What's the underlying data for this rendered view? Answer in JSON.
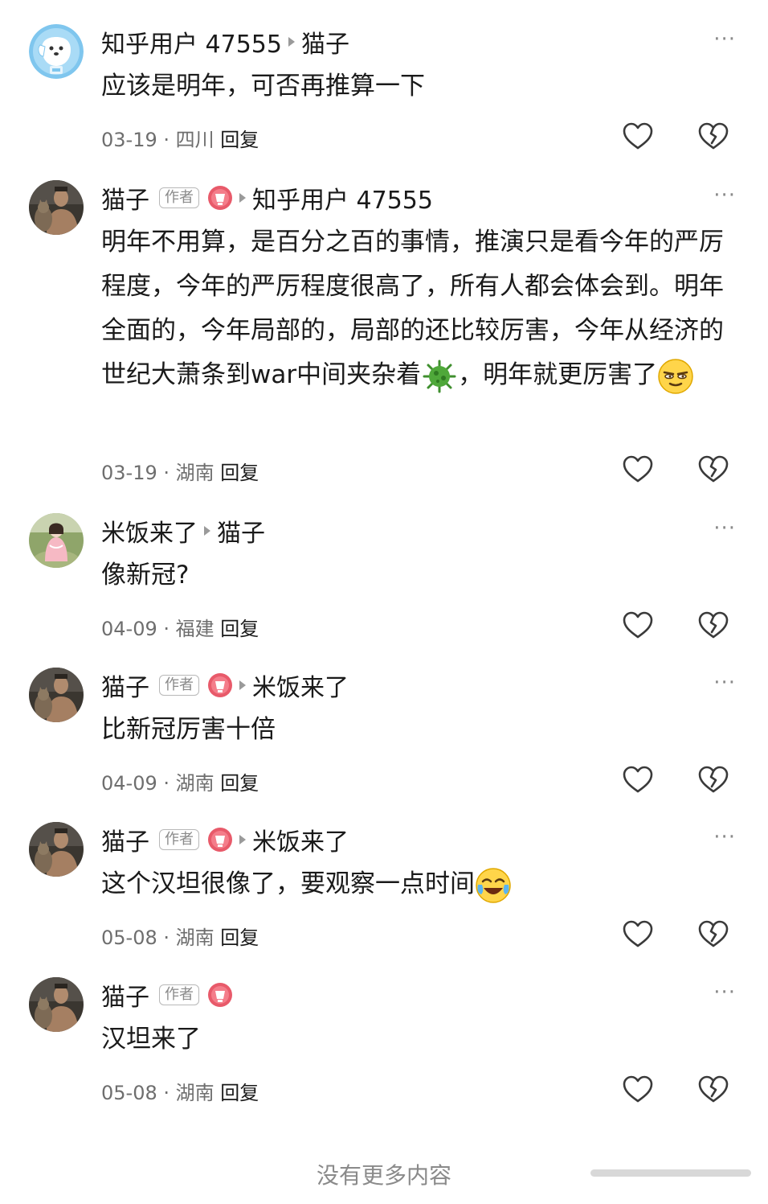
{
  "comments": [
    {
      "author": "知乎用户 47555",
      "is_author": false,
      "reply_to": "猫子",
      "content": "应该是明年，可否再推算一下",
      "date": "03-19",
      "location": "四川",
      "reply_label": "回复",
      "avatar": "dog-avatar"
    },
    {
      "author": "猫子",
      "is_author": true,
      "author_badge": "作者",
      "reply_to": "知乎用户 47555",
      "content_parts": [
        "明年不用算，是百分之百的事情，推演只是看今年的严厉程度，今年的严厉程度很高了，所有人都会体会到。明年全面的，今年局部的，局部的还比较厉害，今年从经济的世纪大萧条到war中间夹杂着",
        "，明年就更厉害了"
      ],
      "emojis": [
        "virus-emoji",
        "smirk-emoji"
      ],
      "date": "03-19",
      "location": "湖南",
      "reply_label": "回复",
      "avatar": "man-with-cat-avatar"
    },
    {
      "author": "米饭来了",
      "is_author": false,
      "reply_to": "猫子",
      "content": "像新冠?",
      "date": "04-09",
      "location": "福建",
      "reply_label": "回复",
      "avatar": "girl-avatar"
    },
    {
      "author": "猫子",
      "is_author": true,
      "author_badge": "作者",
      "reply_to": "米饭来了",
      "content": "比新冠厉害十倍",
      "date": "04-09",
      "location": "湖南",
      "reply_label": "回复",
      "avatar": "man-with-cat-avatar"
    },
    {
      "author": "猫子",
      "is_author": true,
      "author_badge": "作者",
      "reply_to": "米饭来了",
      "content": "这个汉坦很像了，要观察一点时间",
      "emojis": [
        "crying-laughing-emoji"
      ],
      "date": "05-08",
      "location": "湖南",
      "reply_label": "回复",
      "avatar": "man-with-cat-avatar"
    },
    {
      "author": "猫子",
      "is_author": true,
      "author_badge": "作者",
      "reply_to": "",
      "content": "汉坦来了",
      "date": "05-08",
      "location": "湖南",
      "reply_label": "回复",
      "avatar": "man-with-cat-avatar"
    }
  ],
  "more_label": "···",
  "meta_separator": " · ",
  "footer": "没有更多内容",
  "icons": {
    "like": "heart-icon",
    "dislike": "broken-heart-icon",
    "more": "more-icon"
  }
}
